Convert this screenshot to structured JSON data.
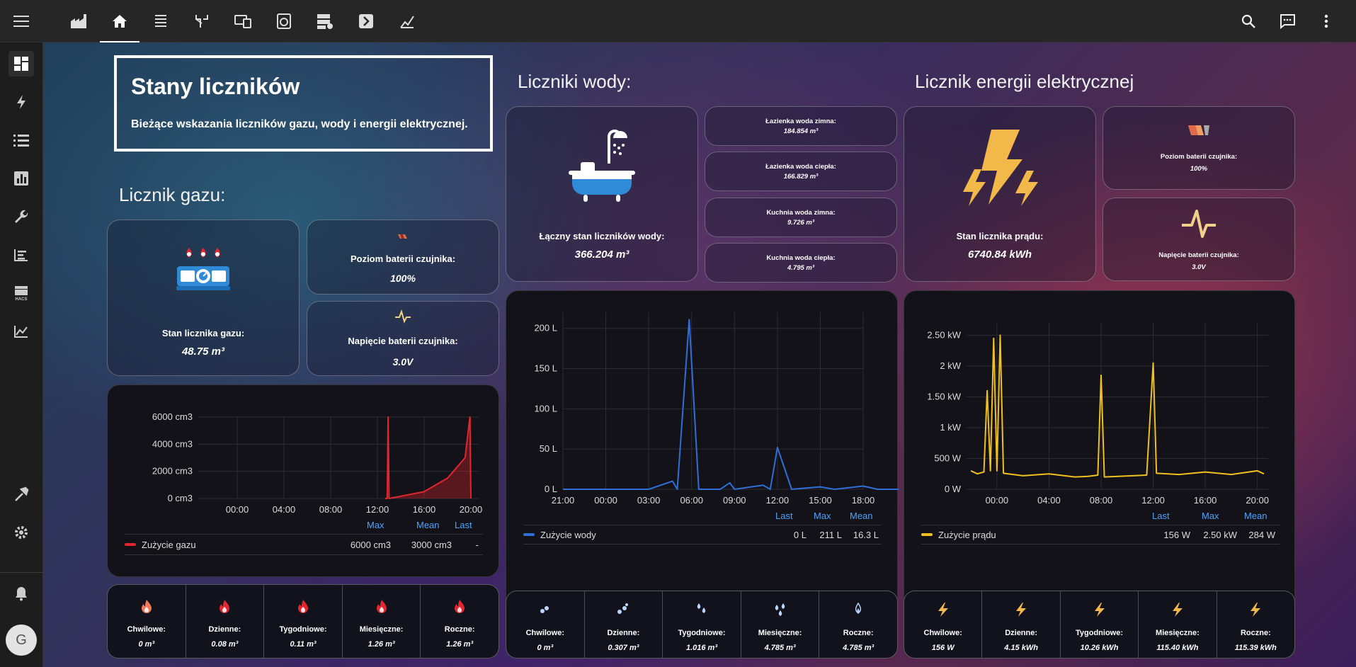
{
  "header": {
    "title": "Stany liczników",
    "subtitle": "Bieżące wskazania liczników gazu, wody i energii elektrycznej."
  },
  "sections": {
    "gas": "Licznik gazu:",
    "water": "Liczniki wody:",
    "electric": "Licznik energii elektrycznej"
  },
  "gas": {
    "meter_label": "Stan licznika gazu:",
    "meter_value": "48.75 m³",
    "battery_label": "Poziom baterii czujnika:",
    "battery_value": "100%",
    "voltage_label": "Napięcie baterii czujnika:",
    "voltage_value": "3.0V",
    "legend": {
      "name": "Zużycie gazu",
      "max": "6000 cm3",
      "mean": "3000 cm3",
      "last": "-"
    },
    "stat_heads": {
      "max": "Max",
      "mean": "Mean",
      "last": "Last"
    },
    "strip": [
      {
        "label": "Chwilowe:",
        "value": "0 m³"
      },
      {
        "label": "Dzienne:",
        "value": "0.08 m³"
      },
      {
        "label": "Tygodniowe:",
        "value": "0.11 m³"
      },
      {
        "label": "Miesięczne:",
        "value": "1.26 m³"
      },
      {
        "label": "Roczne:",
        "value": "1.26 m³"
      }
    ]
  },
  "water": {
    "total_label": "Łączny stan liczników wody:",
    "total_value": "366.204 m³",
    "meters": [
      {
        "label": "Łazienka woda zimna:",
        "value": "184.854 m³"
      },
      {
        "label": "Łazienka woda ciepła:",
        "value": "166.829 m³"
      },
      {
        "label": "Kuchnia woda zimna:",
        "value": "9.726 m³"
      },
      {
        "label": "Kuchnia woda ciepła:",
        "value": "4.795 m³"
      }
    ],
    "legend": {
      "name": "Zużycie wody",
      "last": "0 L",
      "max": "211 L",
      "mean": "16.3 L"
    },
    "stat_heads": {
      "last": "Last",
      "max": "Max",
      "mean": "Mean"
    },
    "strip": [
      {
        "label": "Chwilowe:",
        "value": "0 m³"
      },
      {
        "label": "Dzienne:",
        "value": "0.307 m³"
      },
      {
        "label": "Tygodniowe:",
        "value": "1.016 m³"
      },
      {
        "label": "Miesięczne:",
        "value": "4.785 m³"
      },
      {
        "label": "Roczne:",
        "value": "4.785 m³"
      }
    ]
  },
  "electric": {
    "meter_label": "Stan licznika prądu:",
    "meter_value": "6740.84 kWh",
    "battery_label": "Poziom baterii czujnika:",
    "battery_value": "100%",
    "voltage_label": "Napięcie baterii czujnika:",
    "voltage_value": "3.0V",
    "legend": {
      "name": "Zużycie prądu",
      "last": "156 W",
      "max": "2.50 kW",
      "mean": "284 W"
    },
    "stat_heads": {
      "last": "Last",
      "max": "Max",
      "mean": "Mean"
    },
    "strip": [
      {
        "label": "Chwilowe:",
        "value": "156 W"
      },
      {
        "label": "Dzienne:",
        "value": "4.15 kWh"
      },
      {
        "label": "Tygodniowe:",
        "value": "10.26 kWh"
      },
      {
        "label": "Miesięczne:",
        "value": "115.40 kWh"
      },
      {
        "label": "Roczne:",
        "value": "115.39 kWh"
      }
    ]
  },
  "colors": {
    "gas": "#e0262f",
    "water": "#2f6fd6",
    "electric": "#f0c020",
    "accent_link": "#4aa3ff"
  },
  "icons": {
    "top": [
      "factory-icon",
      "home-icon",
      "layers-icon",
      "pipe-icon",
      "devices-icon",
      "washing-machine-icon",
      "server-icon",
      "arrow-box-icon",
      "chart-icon"
    ],
    "side": [
      "dashboard-icon",
      "lightning-icon",
      "list-icon",
      "bar-chart-icon",
      "wrench-icon",
      "logbook-icon",
      "hacs-icon",
      "history-icon"
    ]
  },
  "user": {
    "avatar_initial": "G"
  },
  "chart_data": [
    {
      "type": "area",
      "title": "",
      "series": [
        {
          "name": "Zużycie gazu",
          "values": [
            0,
            0,
            6000,
            0,
            500,
            1500,
            3000,
            6000,
            0
          ]
        }
      ],
      "x": [
        "12:40",
        "12:50",
        "12:55",
        "13:00",
        "16:00",
        "18:00",
        "19:30",
        "19:55",
        "20:00"
      ],
      "x_ticks": [
        "00:00",
        "04:00",
        "08:00",
        "12:00",
        "16:00",
        "20:00"
      ],
      "y_ticks": [
        "0 cm3",
        "2000 cm3",
        "4000 cm3",
        "6000 cm3"
      ],
      "ylim": [
        0,
        6000
      ]
    },
    {
      "type": "line",
      "title": "",
      "series": [
        {
          "name": "Zużycie wody",
          "values": [
            0,
            0,
            0,
            10,
            0,
            211,
            0,
            0,
            8,
            0,
            5,
            0,
            52,
            0,
            3,
            0,
            4,
            0,
            0
          ]
        }
      ],
      "x": [
        "21:00",
        "00:00",
        "03:00",
        "04:40",
        "05:00",
        "05:50",
        "06:30",
        "08:00",
        "08:40",
        "09:00",
        "11:00",
        "11:30",
        "12:00",
        "13:00",
        "15:00",
        "16:00",
        "18:00",
        "19:00",
        "20:40"
      ],
      "x_ticks": [
        "21:00",
        "00:00",
        "03:00",
        "06:00",
        "09:00",
        "12:00",
        "15:00",
        "18:00"
      ],
      "y_ticks": [
        "0 L",
        "50 L",
        "100 L",
        "150 L",
        "200 L"
      ],
      "ylim": [
        0,
        220
      ]
    },
    {
      "type": "line",
      "title": "",
      "series": [
        {
          "name": "Zużycie prądu",
          "values": [
            300,
            250,
            280,
            1600,
            300,
            2450,
            300,
            2500,
            260,
            220,
            250,
            200,
            210,
            230,
            1850,
            200,
            230,
            2050,
            260,
            240,
            280,
            240,
            300,
            250
          ]
        }
      ],
      "x": [
        "22:00",
        "22:30",
        "23:00",
        "23:15",
        "23:30",
        "23:45",
        "00:00",
        "00:15",
        "00:30",
        "02:00",
        "04:00",
        "06:00",
        "07:00",
        "07:45",
        "08:00",
        "08:15",
        "11:30",
        "12:00",
        "12:15",
        "14:00",
        "16:00",
        "18:00",
        "20:00",
        "20:30"
      ],
      "x_ticks": [
        "00:00",
        "04:00",
        "08:00",
        "12:00",
        "16:00",
        "20:00"
      ],
      "y_ticks": [
        "0 W",
        "500 W",
        "1 kW",
        "1.50 kW",
        "2 kW",
        "2.50 kW"
      ],
      "ylim": [
        0,
        2700
      ]
    }
  ]
}
